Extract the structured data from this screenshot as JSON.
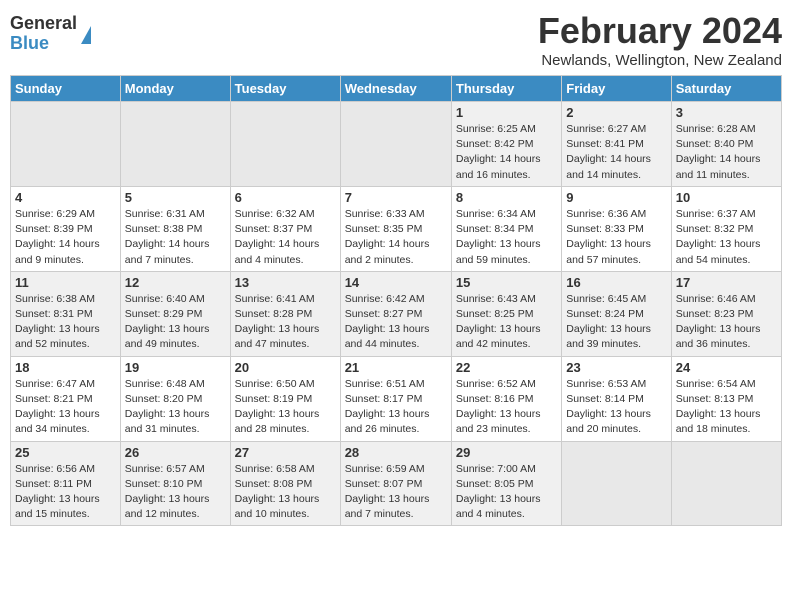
{
  "logo": {
    "general": "General",
    "blue": "Blue"
  },
  "title": {
    "month": "February 2024",
    "location": "Newlands, Wellington, New Zealand"
  },
  "weekdays": [
    "Sunday",
    "Monday",
    "Tuesday",
    "Wednesday",
    "Thursday",
    "Friday",
    "Saturday"
  ],
  "weeks": [
    [
      {
        "day": "",
        "info": ""
      },
      {
        "day": "",
        "info": ""
      },
      {
        "day": "",
        "info": ""
      },
      {
        "day": "",
        "info": ""
      },
      {
        "day": "1",
        "info": "Sunrise: 6:25 AM\nSunset: 8:42 PM\nDaylight: 14 hours and 16 minutes."
      },
      {
        "day": "2",
        "info": "Sunrise: 6:27 AM\nSunset: 8:41 PM\nDaylight: 14 hours and 14 minutes."
      },
      {
        "day": "3",
        "info": "Sunrise: 6:28 AM\nSunset: 8:40 PM\nDaylight: 14 hours and 11 minutes."
      }
    ],
    [
      {
        "day": "4",
        "info": "Sunrise: 6:29 AM\nSunset: 8:39 PM\nDaylight: 14 hours and 9 minutes."
      },
      {
        "day": "5",
        "info": "Sunrise: 6:31 AM\nSunset: 8:38 PM\nDaylight: 14 hours and 7 minutes."
      },
      {
        "day": "6",
        "info": "Sunrise: 6:32 AM\nSunset: 8:37 PM\nDaylight: 14 hours and 4 minutes."
      },
      {
        "day": "7",
        "info": "Sunrise: 6:33 AM\nSunset: 8:35 PM\nDaylight: 14 hours and 2 minutes."
      },
      {
        "day": "8",
        "info": "Sunrise: 6:34 AM\nSunset: 8:34 PM\nDaylight: 13 hours and 59 minutes."
      },
      {
        "day": "9",
        "info": "Sunrise: 6:36 AM\nSunset: 8:33 PM\nDaylight: 13 hours and 57 minutes."
      },
      {
        "day": "10",
        "info": "Sunrise: 6:37 AM\nSunset: 8:32 PM\nDaylight: 13 hours and 54 minutes."
      }
    ],
    [
      {
        "day": "11",
        "info": "Sunrise: 6:38 AM\nSunset: 8:31 PM\nDaylight: 13 hours and 52 minutes."
      },
      {
        "day": "12",
        "info": "Sunrise: 6:40 AM\nSunset: 8:29 PM\nDaylight: 13 hours and 49 minutes."
      },
      {
        "day": "13",
        "info": "Sunrise: 6:41 AM\nSunset: 8:28 PM\nDaylight: 13 hours and 47 minutes."
      },
      {
        "day": "14",
        "info": "Sunrise: 6:42 AM\nSunset: 8:27 PM\nDaylight: 13 hours and 44 minutes."
      },
      {
        "day": "15",
        "info": "Sunrise: 6:43 AM\nSunset: 8:25 PM\nDaylight: 13 hours and 42 minutes."
      },
      {
        "day": "16",
        "info": "Sunrise: 6:45 AM\nSunset: 8:24 PM\nDaylight: 13 hours and 39 minutes."
      },
      {
        "day": "17",
        "info": "Sunrise: 6:46 AM\nSunset: 8:23 PM\nDaylight: 13 hours and 36 minutes."
      }
    ],
    [
      {
        "day": "18",
        "info": "Sunrise: 6:47 AM\nSunset: 8:21 PM\nDaylight: 13 hours and 34 minutes."
      },
      {
        "day": "19",
        "info": "Sunrise: 6:48 AM\nSunset: 8:20 PM\nDaylight: 13 hours and 31 minutes."
      },
      {
        "day": "20",
        "info": "Sunrise: 6:50 AM\nSunset: 8:19 PM\nDaylight: 13 hours and 28 minutes."
      },
      {
        "day": "21",
        "info": "Sunrise: 6:51 AM\nSunset: 8:17 PM\nDaylight: 13 hours and 26 minutes."
      },
      {
        "day": "22",
        "info": "Sunrise: 6:52 AM\nSunset: 8:16 PM\nDaylight: 13 hours and 23 minutes."
      },
      {
        "day": "23",
        "info": "Sunrise: 6:53 AM\nSunset: 8:14 PM\nDaylight: 13 hours and 20 minutes."
      },
      {
        "day": "24",
        "info": "Sunrise: 6:54 AM\nSunset: 8:13 PM\nDaylight: 13 hours and 18 minutes."
      }
    ],
    [
      {
        "day": "25",
        "info": "Sunrise: 6:56 AM\nSunset: 8:11 PM\nDaylight: 13 hours and 15 minutes."
      },
      {
        "day": "26",
        "info": "Sunrise: 6:57 AM\nSunset: 8:10 PM\nDaylight: 13 hours and 12 minutes."
      },
      {
        "day": "27",
        "info": "Sunrise: 6:58 AM\nSunset: 8:08 PM\nDaylight: 13 hours and 10 minutes."
      },
      {
        "day": "28",
        "info": "Sunrise: 6:59 AM\nSunset: 8:07 PM\nDaylight: 13 hours and 7 minutes."
      },
      {
        "day": "29",
        "info": "Sunrise: 7:00 AM\nSunset: 8:05 PM\nDaylight: 13 hours and 4 minutes."
      },
      {
        "day": "",
        "info": ""
      },
      {
        "day": "",
        "info": ""
      }
    ]
  ]
}
